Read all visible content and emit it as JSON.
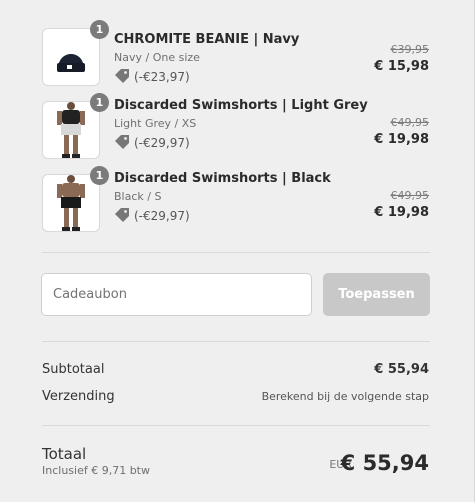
{
  "items": [
    {
      "name": "CHROMITE BEANIE | Navy",
      "variant": "Navy / One size",
      "discount": "(-€23,97)",
      "original_price": "€39,95",
      "price": "€ 15,98",
      "quantity": "1"
    },
    {
      "name": "Discarded Swimshorts | Light Grey",
      "variant": "Light Grey / XS",
      "discount": "(-€29,97)",
      "original_price": "€49,95",
      "price": "€ 19,98",
      "quantity": "1"
    },
    {
      "name": "Discarded Swimshorts | Black",
      "variant": "Black / S",
      "discount": "(-€29,97)",
      "original_price": "€49,95",
      "price": "€ 19,98",
      "quantity": "1"
    }
  ],
  "giftcard": {
    "placeholder": "Cadeaubon",
    "button_label": "Toepassen"
  },
  "summary": {
    "subtotal_label": "Subtotaal",
    "subtotal_value": "€ 55,94",
    "shipping_label": "Verzending",
    "shipping_value": "Berekend bij de volgende stap",
    "total_label": "Totaal",
    "tax_note": "Inclusief € 9,71 btw",
    "currency": "EUR",
    "total_value": "€ 55,94"
  },
  "colors": {
    "background": "#efefef",
    "badge": "#7b7b7b",
    "button_disabled": "#c8c8c8"
  },
  "icons": {
    "discount": "tag-icon"
  }
}
